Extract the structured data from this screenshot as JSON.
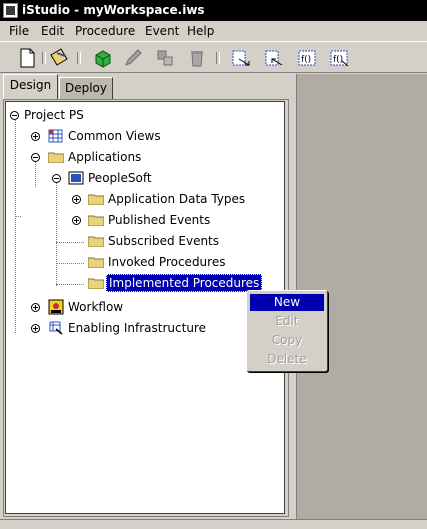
{
  "window": {
    "title": "iStudio - myWorkspace.iws"
  },
  "menubar": {
    "items": [
      {
        "label": "File"
      },
      {
        "label": "Edit"
      },
      {
        "label": "Procedure"
      },
      {
        "label": "Event"
      },
      {
        "label": "Help"
      }
    ]
  },
  "toolbar": {
    "buttons": [
      "new-document-icon",
      "open-icon",
      "deploy-icon",
      "edit-pencil-icon",
      "copy-objects-icon",
      "delete-icon",
      "export-icon",
      "import-icon",
      "function-icon",
      "function-export-icon"
    ]
  },
  "tabs": [
    {
      "label": "Design",
      "active": true
    },
    {
      "label": "Deploy",
      "active": false
    }
  ],
  "tree": {
    "root": "Project PS",
    "common_views": "Common Views",
    "applications": "Applications",
    "peoplesoft": "PeopleSoft",
    "application_data_types": "Application Data Types",
    "published_events": "Published Events",
    "subscribed_events": "Subscribed Events",
    "invoked_procedures": "Invoked Procedures",
    "implemented_procedures": "Implemented Procedures",
    "workflow": "Workflow",
    "enabling_infrastructure": "Enabling Infrastructure"
  },
  "context_menu": {
    "items": [
      {
        "label": "New",
        "enabled": true,
        "highlighted": true
      },
      {
        "label": "Edit",
        "enabled": false
      },
      {
        "label": "Copy",
        "enabled": false
      },
      {
        "label": "Delete",
        "enabled": false
      }
    ]
  },
  "colors": {
    "selection": "#0000b0",
    "chrome": "#d4d0c8",
    "folder": "#e8d27a"
  }
}
